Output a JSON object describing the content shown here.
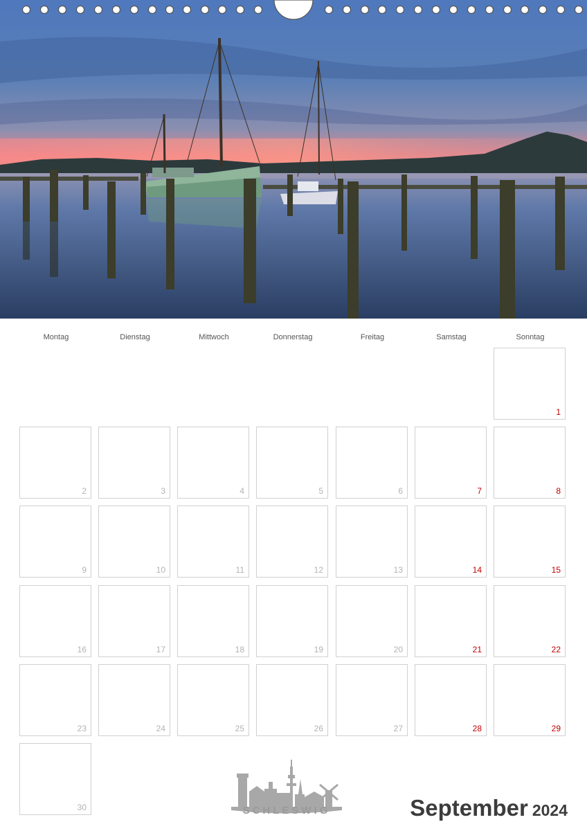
{
  "weekdays": [
    "Montag",
    "Dienstag",
    "Mittwoch",
    "Donnerstag",
    "Freitag",
    "Samstag",
    "Sonntag"
  ],
  "calendar": {
    "first_weekday_index": 6,
    "days_in_month": 30,
    "days": [
      "1",
      "2",
      "3",
      "4",
      "5",
      "6",
      "7",
      "8",
      "9",
      "10",
      "11",
      "12",
      "13",
      "14",
      "15",
      "16",
      "17",
      "18",
      "19",
      "20",
      "21",
      "22",
      "23",
      "24",
      "25",
      "26",
      "27",
      "28",
      "29",
      "30"
    ]
  },
  "title": {
    "month": "September",
    "year": "2024"
  },
  "logo": {
    "text": "SCHLESWIG"
  },
  "colors": {
    "weekday_number": "#b3b3b3",
    "weekend_number": "#c00000",
    "cell_border": "#d0d0d0",
    "title": "#3c3c3c",
    "logo": "#9a9a9a"
  }
}
